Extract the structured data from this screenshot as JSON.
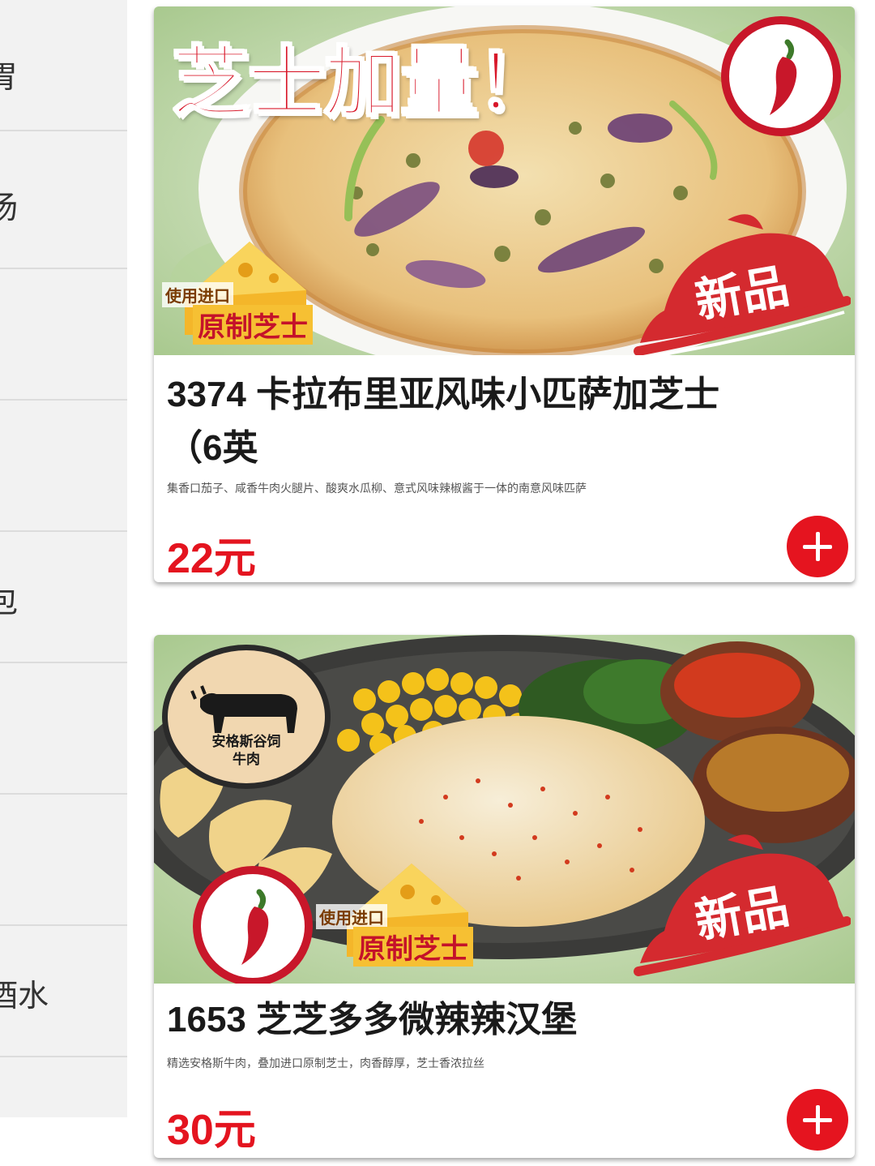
{
  "sidebar": {
    "items": [
      {
        "label": "胃"
      },
      {
        "label": "汤"
      },
      {
        "label": ""
      },
      {
        "label": ""
      },
      {
        "label": "包"
      },
      {
        "label": ""
      },
      {
        "label": ""
      },
      {
        "label": "酒水"
      }
    ]
  },
  "products": [
    {
      "title": "3374 卡拉布里亚风味小匹萨加芝士（6英",
      "description": "集香口茄子、咸香牛肉火腿片、酸爽水瓜柳、意式风味辣椒酱于一体的南意风味匹萨",
      "price": "22元",
      "image": {
        "promo_text": "芝士加量！",
        "cheese_small": "使用进口",
        "cheese_big": "原制芝士",
        "new_label": "新品"
      }
    },
    {
      "title": "1653 芝芝多多微辣辣汉堡",
      "description": "精选安格斯牛肉，叠加进口原制芝士，肉香醇厚，芝士香浓拉丝",
      "price": "30元",
      "image": {
        "beef_line1": "安格斯谷饲",
        "beef_line2": "牛肉",
        "cheese_small": "使用进口",
        "cheese_big": "原制芝士",
        "new_label": "新品"
      }
    }
  ],
  "colors": {
    "accent": "#e5141f",
    "price": "#e4141f",
    "sidebar_bg": "#f2f2f2"
  },
  "icons": [
    "chili-icon",
    "cow-icon",
    "cheese-icon",
    "cloche-icon",
    "plus-icon"
  ]
}
